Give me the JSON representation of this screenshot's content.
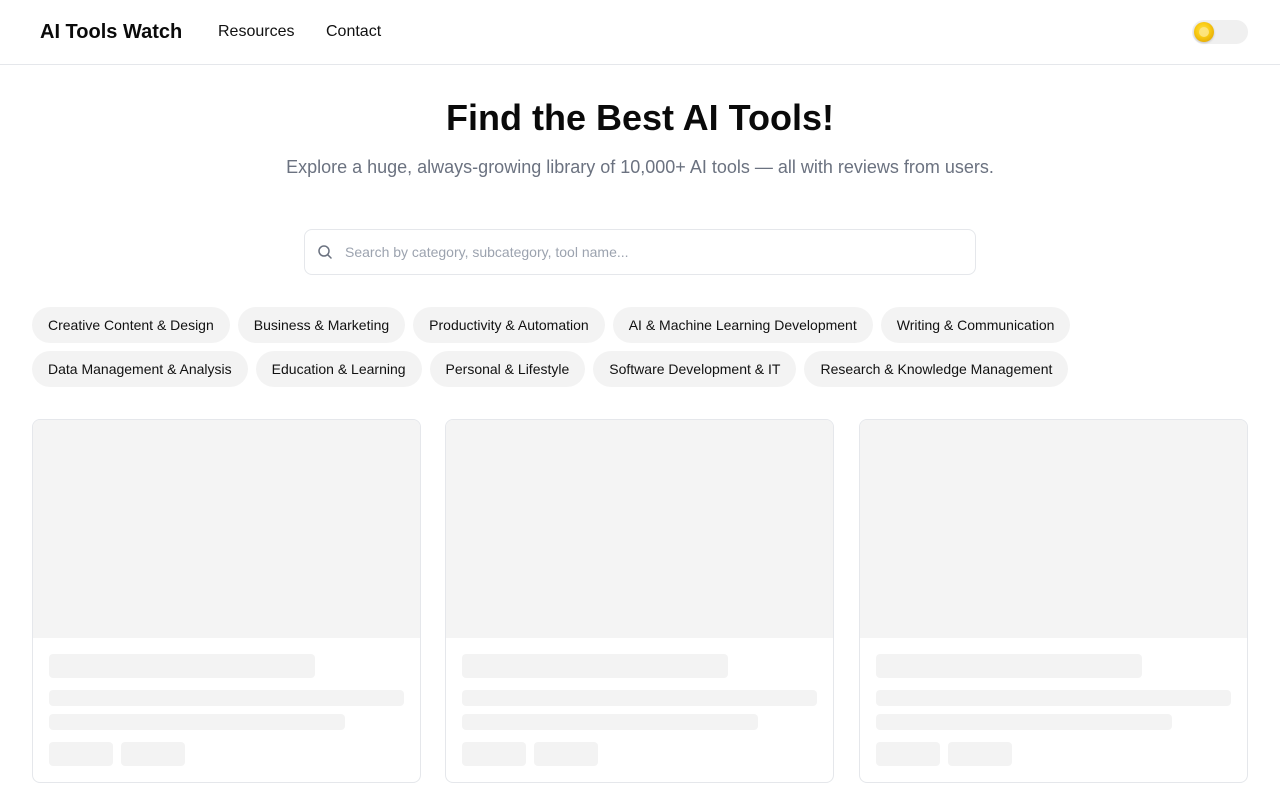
{
  "header": {
    "brand": "AI Tools Watch",
    "nav": {
      "resources": "Resources",
      "contact": "Contact"
    },
    "theme_toggle": {
      "state": "light",
      "icon": "sun-icon",
      "accent": "#facc15"
    }
  },
  "hero": {
    "title": "Find the Best AI Tools!",
    "subtitle": "Explore a huge, always-growing library of 10,000+ AI tools — all with reviews from users."
  },
  "search": {
    "placeholder": "Search by category, subcategory, tool name...",
    "value": "",
    "icon": "search-icon"
  },
  "categories": [
    "Creative Content & Design",
    "Business & Marketing",
    "Productivity & Automation",
    "AI & Machine Learning Development",
    "Writing & Communication",
    "Data Management & Analysis",
    "Education & Learning",
    "Personal & Lifestyle",
    "Software Development & IT",
    "Research & Knowledge Management"
  ],
  "tool_cards": {
    "count": 3,
    "state": "loading"
  },
  "colors": {
    "border": "#e5e7eb",
    "skeleton": "#f3f3f3",
    "muted_text": "#6b7280",
    "chip_bg": "#f3f3f3"
  }
}
